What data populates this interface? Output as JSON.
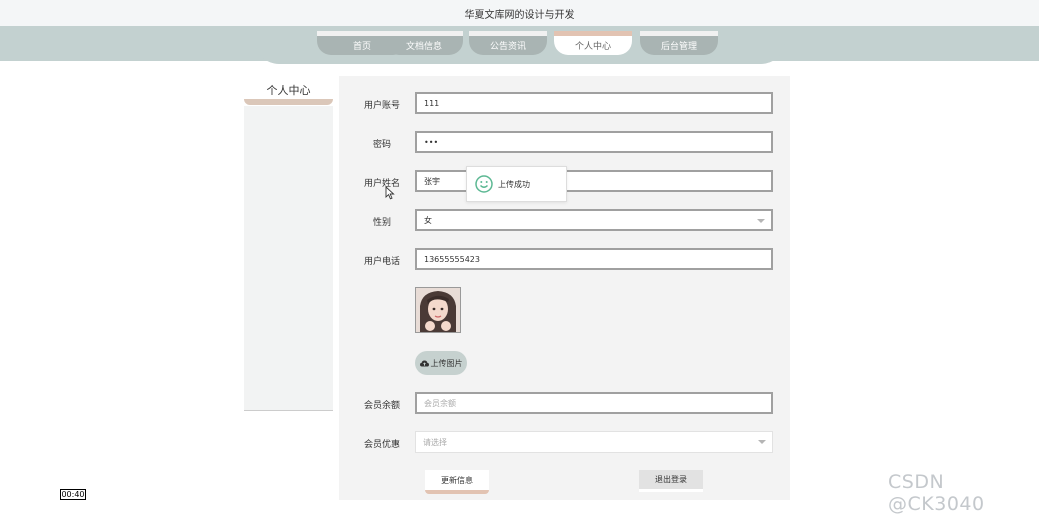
{
  "header": {
    "site_title": "华夏文库网的设计与开发"
  },
  "nav": {
    "tabs": [
      {
        "label": "首页",
        "active": false
      },
      {
        "label": "文档信息",
        "active": false
      },
      {
        "label": "公告资讯",
        "active": false
      },
      {
        "label": "个人中心",
        "active": true
      },
      {
        "label": "后台管理",
        "active": false
      }
    ]
  },
  "sidebar": {
    "title": "个人中心"
  },
  "form": {
    "account": {
      "label": "用户账号",
      "value": "111"
    },
    "password": {
      "label": "密码",
      "value": "•••"
    },
    "name": {
      "label": "用户姓名",
      "value": "张宇"
    },
    "gender": {
      "label": "性别",
      "value": "女"
    },
    "phone": {
      "label": "用户电话",
      "value": "13655555423"
    },
    "upload_label": "上传图片",
    "balance": {
      "label": "会员余额",
      "placeholder": "会员余额"
    },
    "discount": {
      "label": "会员优惠",
      "placeholder": "请选择"
    }
  },
  "actions": {
    "update_label": "更新信息",
    "logout_label": "退出登录"
  },
  "toast": {
    "message": "上传成功",
    "icon": "smile-icon"
  },
  "overlay": {
    "timer": "00:40",
    "watermark": "CSDN @CK3040"
  },
  "colors": {
    "nav_band": "#c3d1d0",
    "tab": "#a9b4b3",
    "accent": "#e2c3b2",
    "toast_icon": "#5cb893"
  }
}
